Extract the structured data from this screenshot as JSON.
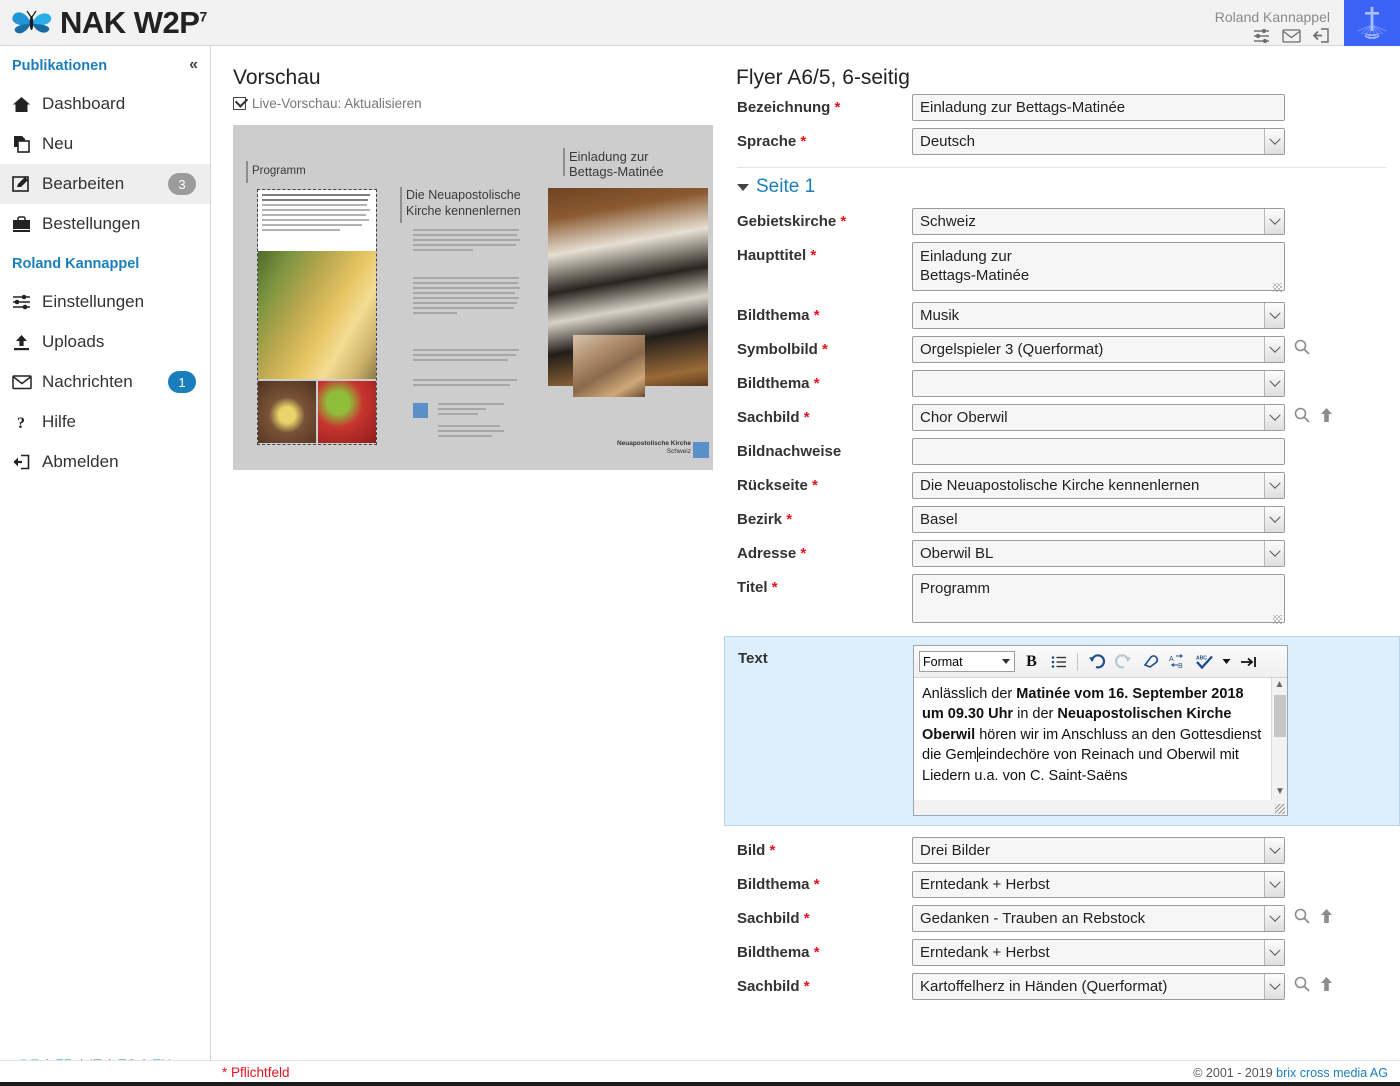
{
  "app": {
    "title": "NAK W2P",
    "title_sup": "7",
    "logo_icon": "butterfly-logo",
    "church_logo_icon": "nak-church-logo"
  },
  "header": {
    "user_name": "Roland Kannappel",
    "icons": [
      {
        "name": "settings-sliders-icon",
        "label": "Einstellungen"
      },
      {
        "name": "mail-icon",
        "label": "Nachrichten"
      },
      {
        "name": "logout-icon",
        "label": "Abmelden"
      }
    ]
  },
  "sidebar": {
    "collapse_icon": "chevron-double-left-icon",
    "sections": [
      {
        "title": "Publikationen",
        "items": [
          {
            "label": "Dashboard",
            "icon": "home-icon",
            "badge": null,
            "active": false
          },
          {
            "label": "Neu",
            "icon": "copy-icon",
            "badge": null,
            "active": false
          },
          {
            "label": "Bearbeiten",
            "icon": "edit-pencil-icon",
            "badge": "3",
            "badge_color": "#9b9b9b",
            "active": true
          },
          {
            "label": "Bestellungen",
            "icon": "briefcase-icon",
            "badge": null,
            "active": false
          }
        ]
      },
      {
        "title": "Roland Kannappel",
        "items": [
          {
            "label": "Einstellungen",
            "icon": "settings-sliders-icon",
            "badge": null,
            "active": false
          },
          {
            "label": "Uploads",
            "icon": "upload-icon",
            "badge": null,
            "active": false
          },
          {
            "label": "Nachrichten",
            "icon": "mail-icon",
            "badge": "1",
            "badge_color": "#1a7ebd",
            "active": false
          },
          {
            "label": "Hilfe",
            "icon": "question-mark-icon",
            "badge": null,
            "active": false
          },
          {
            "label": "Abmelden",
            "icon": "logout-icon",
            "badge": null,
            "active": false
          }
        ]
      }
    ],
    "languages": [
      {
        "code": "DE",
        "active": true
      },
      {
        "code": "FR",
        "active": false
      },
      {
        "code": "IT",
        "active": false
      },
      {
        "code": "ES",
        "active": false
      },
      {
        "code": "EN",
        "active": false
      }
    ]
  },
  "preview": {
    "title": "Vorschau",
    "live_preview_label": "Live-Vorschau: Aktualisieren",
    "live_preview_checked": true,
    "flyer": {
      "panel_left_heading": "Programm",
      "panel_mid_heading": "Die Neuapostolische Kirche kennenlernen",
      "panel_right_heading_line1": "Einladung zur",
      "panel_right_heading_line2": "Bettags-Matinée",
      "footer_brand_line1": "Neuapostolische Kirche",
      "footer_brand_line2": "Schweiz"
    }
  },
  "form": {
    "title": "Flyer A6/5, 6-seitig",
    "page_section": {
      "label": "Seite 1",
      "expanded": true
    },
    "fields_top": [
      {
        "label": "Bezeichnung",
        "required": true,
        "type": "text",
        "value": "Einladung zur Bettags-Matinée"
      },
      {
        "label": "Sprache",
        "required": true,
        "type": "select",
        "value": "Deutsch"
      }
    ],
    "fields_page": [
      {
        "label": "Gebietskirche",
        "required": true,
        "type": "select",
        "value": "Schweiz"
      },
      {
        "label": "Haupttitel",
        "required": true,
        "type": "textarea",
        "value": "Einladung zur\nBettags-Matinée"
      },
      {
        "label": "Bildthema",
        "required": true,
        "type": "select",
        "value": "Musik"
      },
      {
        "label": "Symbolbild",
        "required": true,
        "type": "select",
        "value": "Orgelspieler 3 (Querformat)",
        "actions": [
          "search-icon"
        ]
      },
      {
        "label": "Bildthema",
        "required": true,
        "type": "select",
        "value": ""
      },
      {
        "label": "Sachbild",
        "required": true,
        "type": "select",
        "value": "Chor Oberwil",
        "actions": [
          "search-icon",
          "upload-arrow-icon"
        ]
      },
      {
        "label": "Bildnachweise",
        "required": false,
        "type": "text",
        "value": ""
      },
      {
        "label": "Rückseite",
        "required": true,
        "type": "select",
        "value": "Die Neuapostolische Kirche kennenlernen"
      },
      {
        "label": "Bezirk",
        "required": true,
        "type": "select",
        "value": "Basel"
      },
      {
        "label": "Adresse",
        "required": true,
        "type": "select",
        "value": "Oberwil BL"
      },
      {
        "label": "Titel",
        "required": true,
        "type": "textarea",
        "value": "Programm"
      }
    ],
    "editor": {
      "label": "Text",
      "required": false,
      "format_select_value": "Format",
      "toolbar": [
        {
          "name": "bold-button",
          "glyph": "B"
        },
        {
          "name": "bullet-list-button",
          "glyph": "list"
        },
        {
          "name": "toolbar-separator",
          "glyph": "sep"
        },
        {
          "name": "undo-button",
          "glyph": "undo"
        },
        {
          "name": "redo-button",
          "glyph": "redo"
        },
        {
          "name": "remove-format-eraser-button",
          "glyph": "eraser"
        },
        {
          "name": "find-replace-button",
          "glyph": "replace"
        },
        {
          "name": "spellcheck-button",
          "glyph": "abc"
        },
        {
          "name": "spellcheck-dropdown-button",
          "glyph": "caret"
        },
        {
          "name": "indent-button",
          "glyph": "indent"
        }
      ],
      "content_runs": [
        {
          "text": "Anlässlich der ",
          "bold": false
        },
        {
          "text": "Matinée vom 16. September 2018 um 09.30 Uhr",
          "bold": true
        },
        {
          "text": " in der ",
          "bold": false
        },
        {
          "text": "Neuapostolischen Kirche Oberwil",
          "bold": true
        },
        {
          "text": " hören wir im Anschluss an den Gottesdienst die Gem",
          "bold": false
        },
        {
          "text": "",
          "bold": false,
          "caret": true
        },
        {
          "text": "eindechöre von Reinach und Oberwil mit Liedern u.a. von C. Saint-Saëns",
          "bold": false
        }
      ]
    },
    "fields_bottom": [
      {
        "label": "Bild",
        "required": true,
        "type": "select",
        "value": "Drei Bilder"
      },
      {
        "label": "Bildthema",
        "required": true,
        "type": "select",
        "value": "Erntedank + Herbst"
      },
      {
        "label": "Sachbild",
        "required": true,
        "type": "select",
        "value": "Gedanken - Trauben an Rebstock",
        "actions": [
          "search-icon",
          "upload-arrow-icon"
        ]
      },
      {
        "label": "Bildthema",
        "required": true,
        "type": "select",
        "value": "Erntedank + Herbst"
      },
      {
        "label": "Sachbild",
        "required": true,
        "type": "select",
        "value": "Kartoffelherz in Händen (Querformat)",
        "actions": [
          "search-icon",
          "upload-arrow-icon"
        ]
      }
    ]
  },
  "footer": {
    "required_note": "* Pflichtfeld",
    "copyright": "© 2001 - 2019",
    "company": "brix cross media AG"
  },
  "colors": {
    "accent_blue": "#1a7ebd",
    "required_red": "#e8111c",
    "badge_grey": "#9b9b9b",
    "highlight_row": "#ddeefc",
    "topbar_bg": "#f2f2f2",
    "church_logo_blue": "#3b63f6"
  }
}
